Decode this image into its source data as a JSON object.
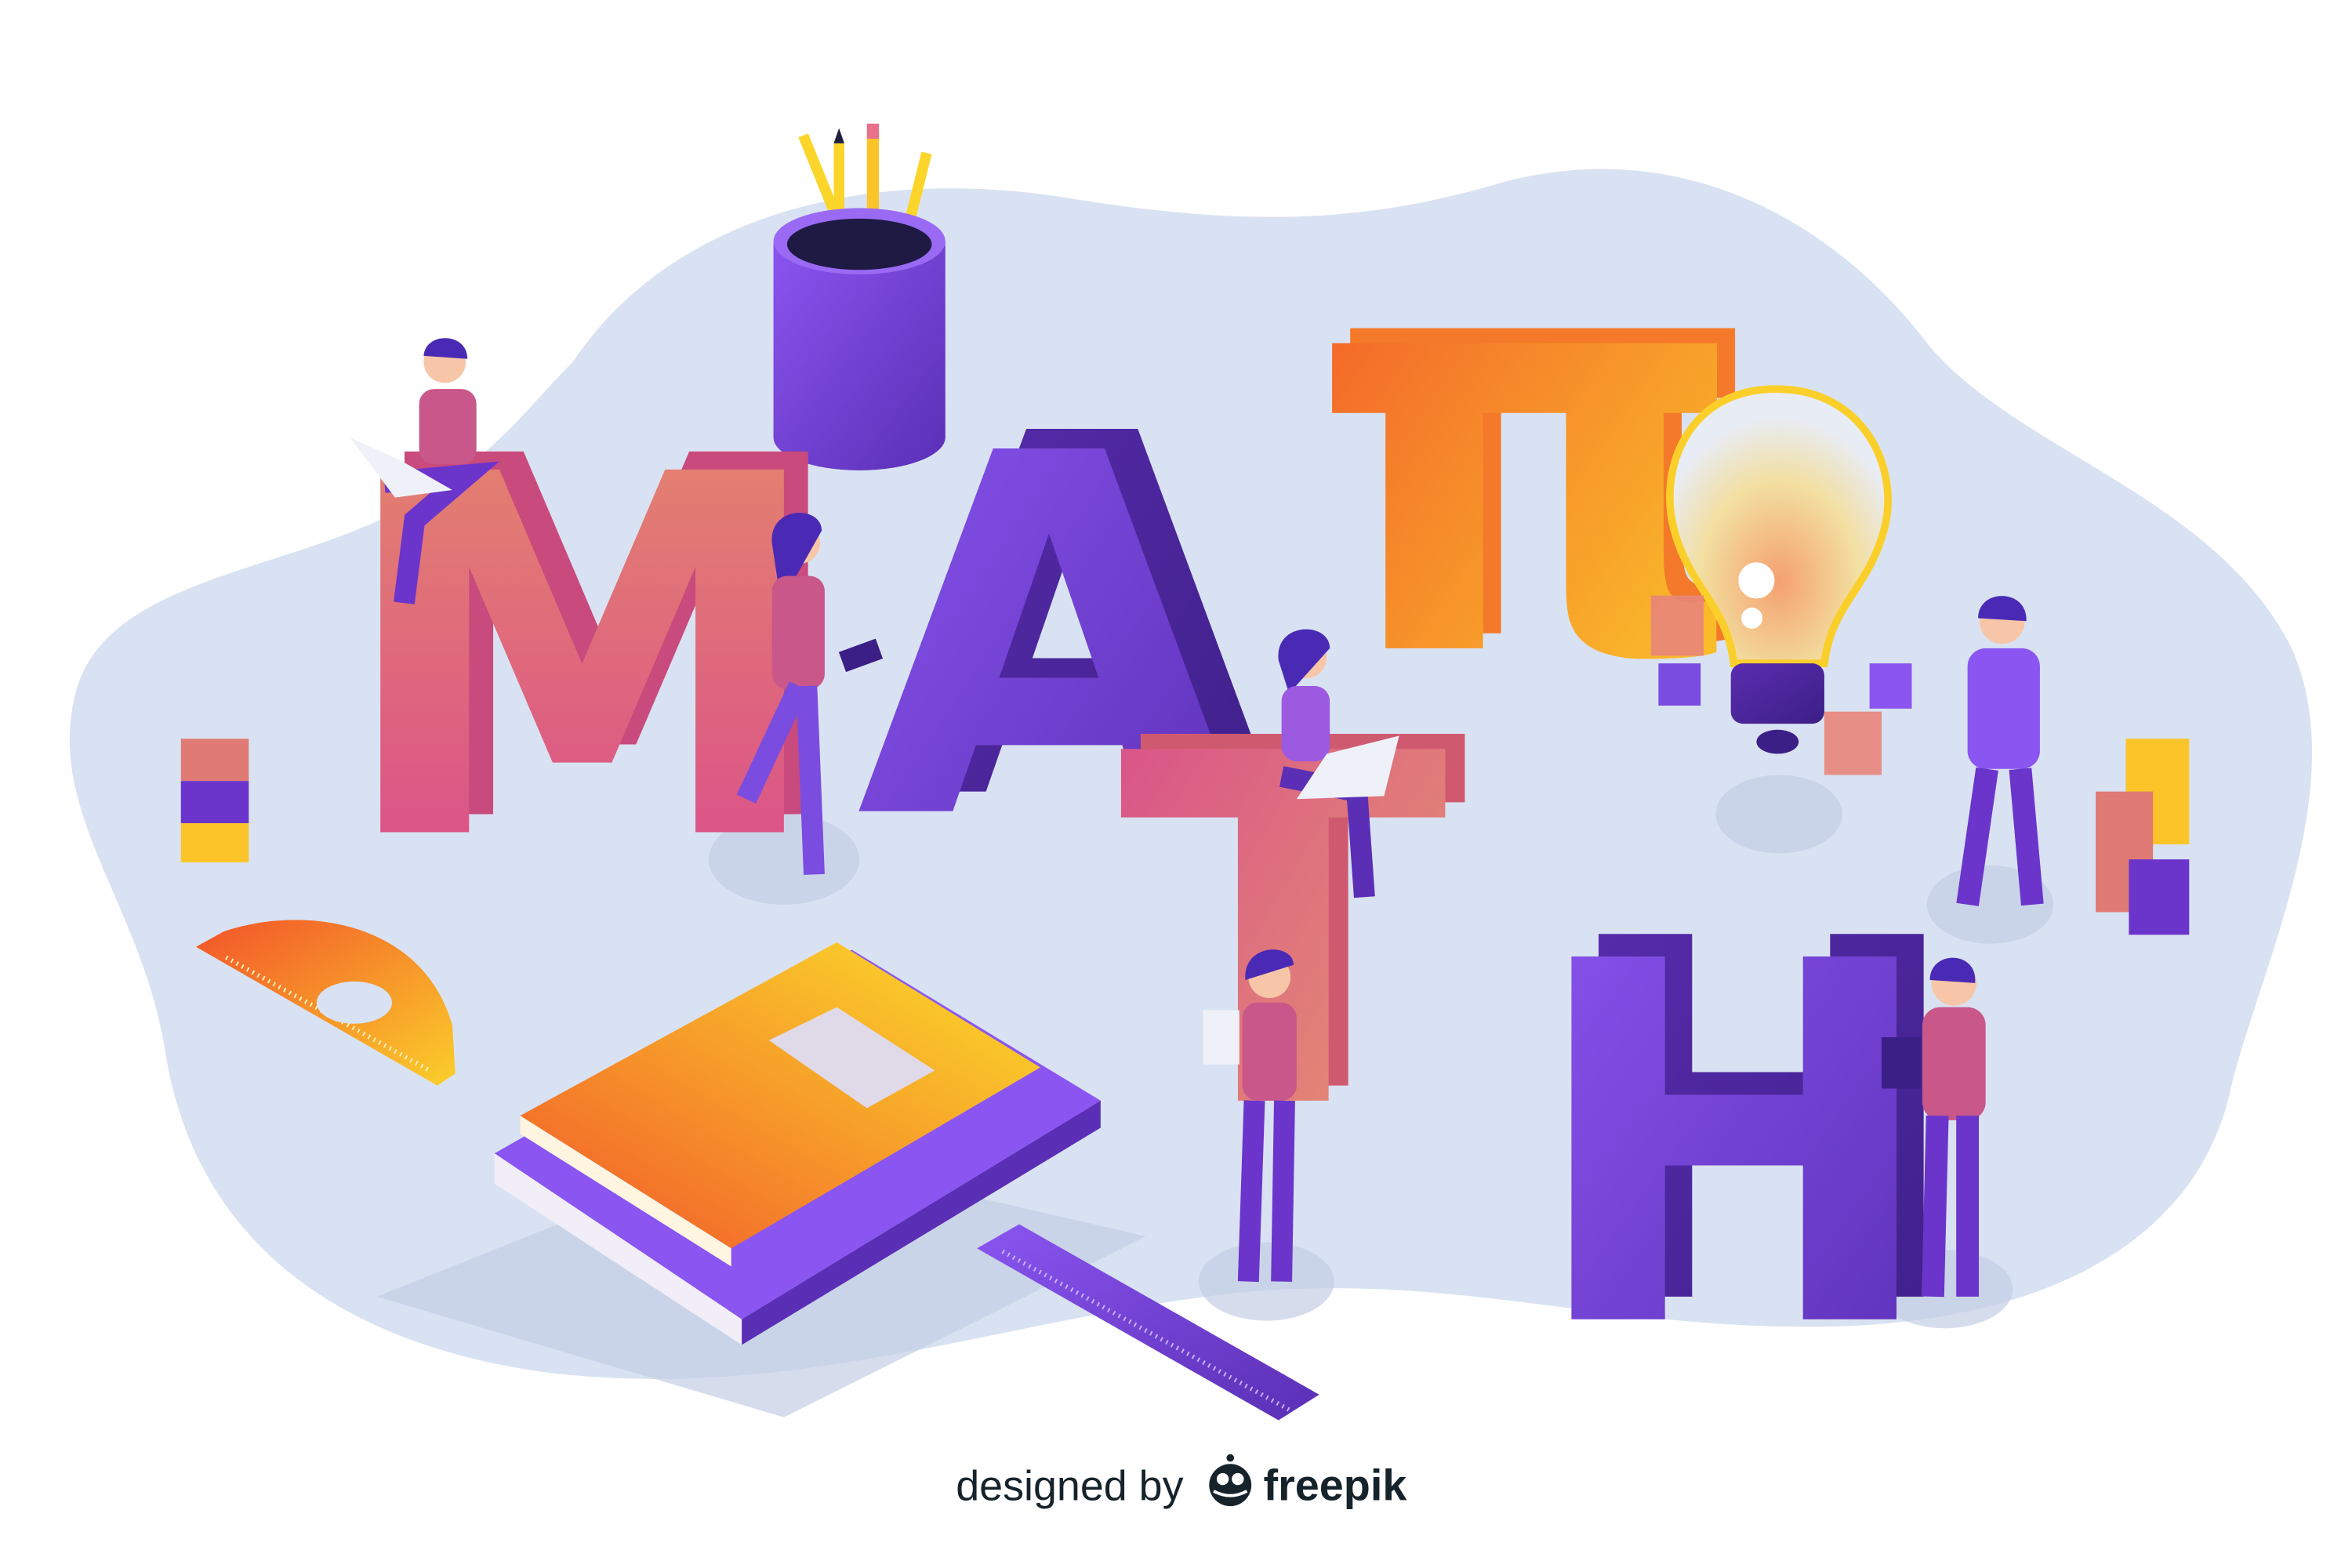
{
  "illustration": {
    "letters": [
      "M",
      "A",
      "π",
      "T",
      "H"
    ]
  },
  "credit": {
    "prefix": "designed by",
    "brand": "freepik"
  },
  "colors": {
    "background": "#ffffff",
    "blob": "#d9e2f2",
    "purple": "#7b4ce0",
    "pink": "#d9508a",
    "orange": "#f7901e",
    "yellow": "#fbd52a",
    "text": "#16232b"
  }
}
